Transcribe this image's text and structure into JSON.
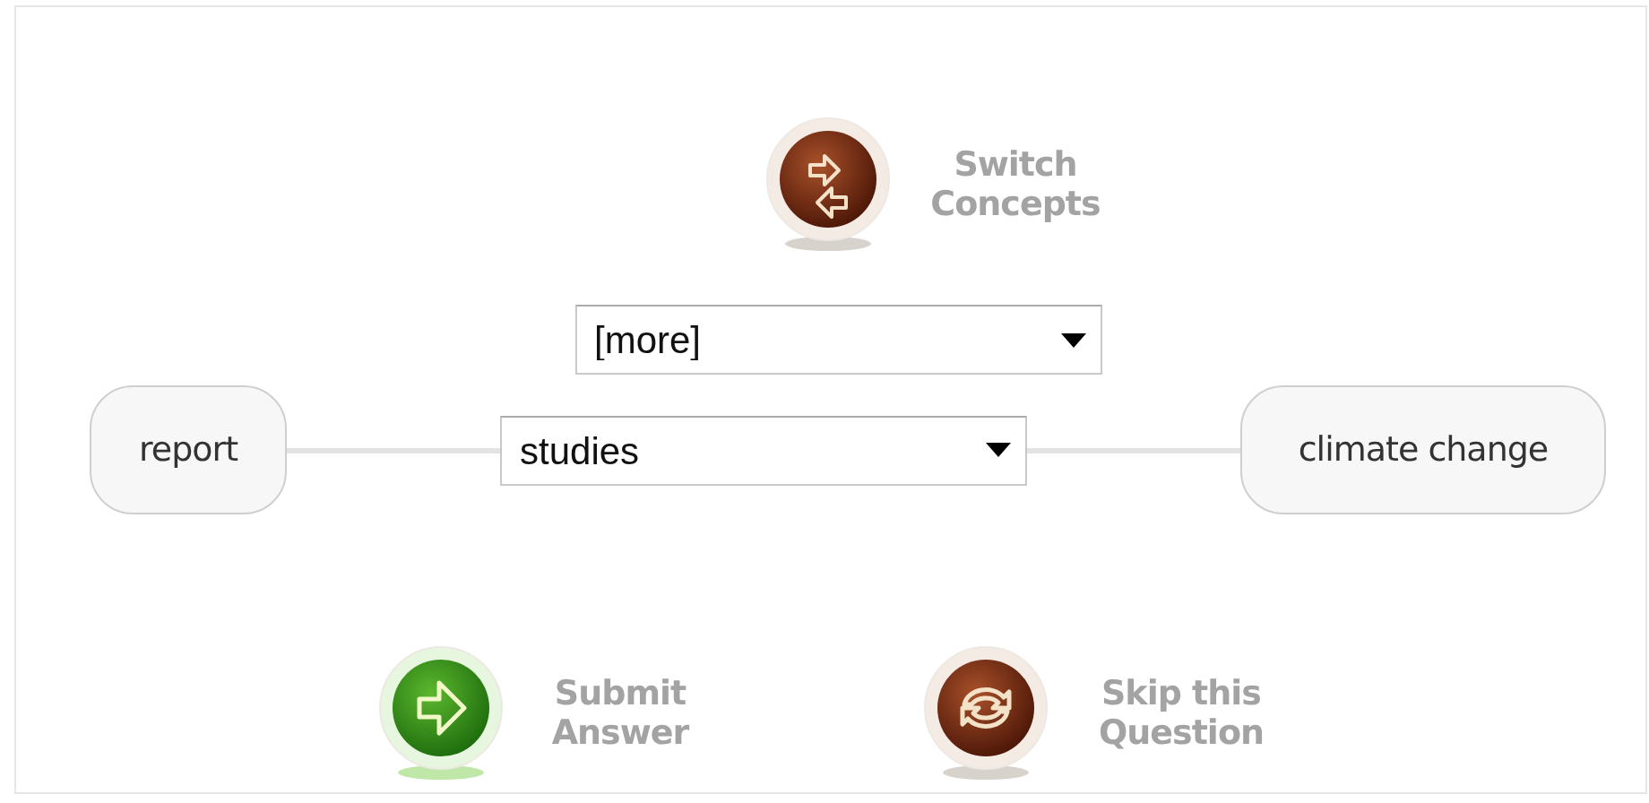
{
  "switch_action": {
    "kind": "switch",
    "label": "Switch Concepts"
  },
  "relation": {
    "source": "report",
    "target": "climate change",
    "dropdowns": [
      {
        "value": "[more]"
      },
      {
        "value": "studies"
      }
    ]
  },
  "actions": [
    {
      "kind": "submit",
      "label": "Submit Answer"
    },
    {
      "kind": "skip",
      "label": "Skip this Question"
    }
  ]
}
